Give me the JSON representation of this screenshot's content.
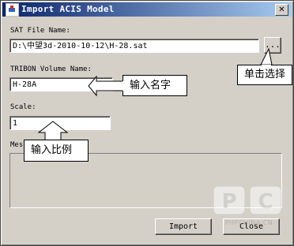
{
  "window": {
    "title": "Import ACIS Model",
    "close_glyph": "✕"
  },
  "sat_file": {
    "label": "SAT File Name:",
    "value": "D:\\中望3d-2010-10-12\\H-28.sat",
    "browse_label": "..."
  },
  "volume": {
    "label": "TRIBON Volume Name:",
    "value": "H-28A"
  },
  "scale": {
    "label": "Scale:",
    "value": "1"
  },
  "messages": {
    "label": "Mes"
  },
  "buttons": {
    "import": "Import",
    "close": "Close"
  },
  "callouts": {
    "browse": "单击选择",
    "name": "输入名字",
    "scale": "输入比例"
  },
  "watermark": {
    "letters": "PC",
    "text": "PHPCHINA.CN"
  },
  "colors": {
    "title_bar_start": "#0a246a",
    "dialog_face": "#d4d0c8"
  }
}
